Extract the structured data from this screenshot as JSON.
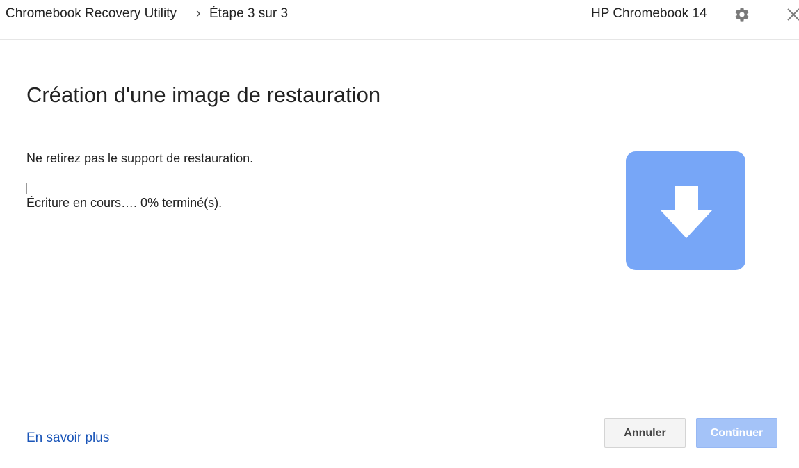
{
  "header": {
    "app_title": "Chromebook Recovery Utility",
    "breadcrumb_separator": "›",
    "step_label": "Étape 3 sur 3",
    "device_name": "HP Chromebook 14",
    "settings_icon": "gear-icon",
    "close_icon": "close-icon"
  },
  "main": {
    "title": "Création d'une image de restauration",
    "instruction": "Ne retirez pas le support de restauration.",
    "progress": {
      "percent": 0,
      "status_text": "Écriture en cours…. 0% terminé(s)."
    },
    "illustration_icon": "download-arrow-icon"
  },
  "footer": {
    "learn_more": "En savoir plus",
    "cancel_label": "Annuler",
    "continue_label": "Continuer"
  },
  "colors": {
    "accent": "#77a6f7",
    "link": "#1a55b8",
    "continue_disabled": "#a4c3f8"
  }
}
